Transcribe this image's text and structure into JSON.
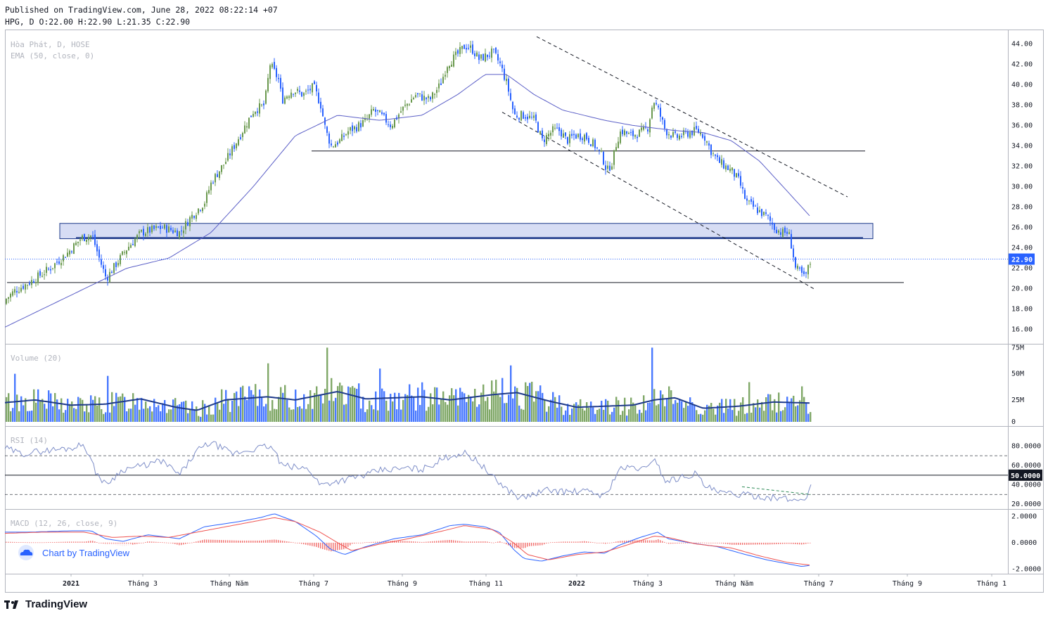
{
  "header": {
    "published": "Published on TradingView.com, June 28, 2022 08:22:14 +07",
    "ohlc": "HPG, D O:22.00 H:22.90 L:21.35 C:22.90"
  },
  "branding": {
    "logo_text": "TradingView",
    "chart_by": "Chart by TradingView"
  },
  "colors": {
    "up": "#6a994e",
    "down": "#2962ff",
    "ema": "#5b5fc7",
    "vol_ma": "#1e3a8a",
    "rsi": "#7e8ec8",
    "macd": "#2962ff",
    "signal": "#ef5350",
    "hist": "#ef5350",
    "zone_fill": "#c9d1f0",
    "zone_stroke": "#1e3a8a",
    "price_tag": "#2962ff"
  },
  "chart_data": [
    {
      "type": "candlestick",
      "title": "Hòa Phát, D, HOSE",
      "indicator": "EMA (50, close, 0)",
      "symbol": "HPG",
      "last_price": "22.90",
      "ylim": [
        14.6,
        45.4
      ],
      "y_ticks": [
        "44.00",
        "42.00",
        "40.00",
        "38.00",
        "36.00",
        "34.00",
        "32.00",
        "30.00",
        "28.00",
        "26.00",
        "24.00",
        "22.00",
        "20.00",
        "18.00",
        "16.00"
      ],
      "x_ticks": [
        "2021",
        "Tháng 3",
        "Tháng Năm",
        "Tháng 7",
        "Tháng 9",
        "Tháng 11",
        "2022",
        "Tháng 3",
        "Tháng Năm",
        "Tháng 7",
        "Tháng 9",
        "Tháng 1"
      ],
      "price_path": [
        [
          0,
          18.5
        ],
        [
          20,
          19.8
        ],
        [
          45,
          20.8
        ],
        [
          70,
          22.0
        ],
        [
          95,
          23.5
        ],
        [
          115,
          25.0
        ],
        [
          130,
          25.2
        ],
        [
          140,
          23.0
        ],
        [
          150,
          21.0
        ],
        [
          160,
          22.0
        ],
        [
          180,
          24.0
        ],
        [
          200,
          25.5
        ],
        [
          230,
          26.0
        ],
        [
          255,
          25.5
        ],
        [
          270,
          27.0
        ],
        [
          290,
          28.5
        ],
        [
          300,
          30.5
        ],
        [
          320,
          32.5
        ],
        [
          340,
          35.0
        ],
        [
          360,
          37.5
        ],
        [
          375,
          38.0
        ],
        [
          383,
          42.0
        ],
        [
          395,
          40.5
        ],
        [
          400,
          38.5
        ],
        [
          415,
          39.5
        ],
        [
          430,
          39.0
        ],
        [
          445,
          39.8
        ],
        [
          455,
          38.0
        ],
        [
          462,
          35.5
        ],
        [
          470,
          34.0
        ],
        [
          482,
          34.5
        ],
        [
          495,
          35.5
        ],
        [
          505,
          35.8
        ],
        [
          520,
          36.5
        ],
        [
          530,
          37.5
        ],
        [
          540,
          37.0
        ],
        [
          555,
          36.0
        ],
        [
          570,
          37.5
        ],
        [
          590,
          39.0
        ],
        [
          610,
          38.5
        ],
        [
          625,
          40.0
        ],
        [
          635,
          42.0
        ],
        [
          650,
          43.0
        ],
        [
          660,
          43.8
        ],
        [
          670,
          43.5
        ],
        [
          680,
          42.5
        ],
        [
          690,
          42.8
        ],
        [
          700,
          43.2
        ],
        [
          710,
          42.0
        ],
        [
          720,
          40.0
        ],
        [
          730,
          37.0
        ],
        [
          745,
          37.0
        ],
        [
          760,
          36.5
        ],
        [
          770,
          34.5
        ],
        [
          785,
          35.5
        ],
        [
          795,
          35.5
        ],
        [
          805,
          34.5
        ],
        [
          815,
          35.0
        ],
        [
          830,
          35.0
        ],
        [
          845,
          34.0
        ],
        [
          855,
          33.0
        ],
        [
          862,
          31.5
        ],
        [
          870,
          32.5
        ],
        [
          876,
          34.5
        ],
        [
          882,
          35.5
        ],
        [
          895,
          35.0
        ],
        [
          910,
          35.3
        ],
        [
          920,
          35.8
        ],
        [
          928,
          38.5
        ],
        [
          935,
          37.5
        ],
        [
          945,
          35.5
        ],
        [
          960,
          34.8
        ],
        [
          975,
          35.2
        ],
        [
          990,
          35.5
        ],
        [
          1000,
          35.0
        ],
        [
          1010,
          33.5
        ],
        [
          1020,
          32.5
        ],
        [
          1030,
          32.0
        ],
        [
          1040,
          31.5
        ],
        [
          1050,
          30.5
        ],
        [
          1060,
          28.5
        ],
        [
          1070,
          28.0
        ],
        [
          1080,
          27.5
        ],
        [
          1090,
          27.0
        ],
        [
          1100,
          26.0
        ],
        [
          1110,
          25.5
        ],
        [
          1120,
          25.5
        ],
        [
          1125,
          24.0
        ],
        [
          1130,
          22.0
        ],
        [
          1138,
          21.5
        ],
        [
          1143,
          21.0
        ],
        [
          1148,
          22.0
        ],
        [
          1153,
          22.9
        ]
      ],
      "ema_path": [
        [
          0,
          16.0
        ],
        [
          60,
          18.0
        ],
        [
          120,
          20.0
        ],
        [
          180,
          22.0
        ],
        [
          240,
          23.0
        ],
        [
          300,
          25.5
        ],
        [
          360,
          30.0
        ],
        [
          420,
          35.0
        ],
        [
          480,
          37.0
        ],
        [
          540,
          36.5
        ],
        [
          600,
          37.0
        ],
        [
          650,
          39.0
        ],
        [
          690,
          41.0
        ],
        [
          720,
          41.0
        ],
        [
          760,
          39.0
        ],
        [
          800,
          37.5
        ],
        [
          860,
          36.5
        ],
        [
          900,
          36.0
        ],
        [
          960,
          35.5
        ],
        [
          1000,
          35.3
        ],
        [
          1040,
          34.5
        ],
        [
          1080,
          32.5
        ],
        [
          1120,
          29.5
        ],
        [
          1153,
          27.0
        ]
      ],
      "support_lines": [
        {
          "x": [
            443,
            1230
          ],
          "y": 33.5
        },
        {
          "x": [
            108,
            1227
          ],
          "y": 25.0
        },
        {
          "x": [
            10,
            1285
          ],
          "y": 20.6
        }
      ],
      "zone": {
        "x": [
          85,
          1241
        ],
        "y": [
          24.9,
          26.4
        ]
      },
      "trendlines": [
        {
          "from": [
            763,
            44.7
          ],
          "to": [
            1205,
            29.0
          ]
        },
        {
          "from": [
            714,
            37.3
          ],
          "to": [
            1157,
            20.0
          ]
        }
      ]
    },
    {
      "type": "bar",
      "title": "Volume (20)",
      "ylim": [
        0,
        78
      ],
      "y_ticks": [
        "75M",
        "50M",
        "25M",
        "0"
      ],
      "spikes": [
        [
          20,
          50
        ],
        [
          153,
          48
        ],
        [
          381,
          60
        ],
        [
          465,
          75
        ],
        [
          538,
          55
        ],
        [
          724,
          58
        ],
        [
          925,
          75
        ],
        [
          1063,
          42
        ],
        [
          1140,
          38
        ]
      ],
      "ma_path": [
        [
          0,
          22
        ],
        [
          50,
          25
        ],
        [
          100,
          20
        ],
        [
          150,
          21
        ],
        [
          200,
          26
        ],
        [
          250,
          18
        ],
        [
          280,
          15
        ],
        [
          320,
          25
        ],
        [
          380,
          28
        ],
        [
          420,
          25
        ],
        [
          480,
          33
        ],
        [
          520,
          26
        ],
        [
          600,
          28
        ],
        [
          640,
          25
        ],
        [
          700,
          30
        ],
        [
          735,
          32
        ],
        [
          780,
          24
        ],
        [
          820,
          18
        ],
        [
          860,
          19
        ],
        [
          900,
          20
        ],
        [
          930,
          25
        ],
        [
          960,
          27
        ],
        [
          1000,
          17
        ],
        [
          1050,
          19
        ],
        [
          1100,
          23
        ],
        [
          1153,
          22
        ]
      ]
    },
    {
      "type": "line",
      "title": "RSI (14)",
      "ylim": [
        15,
        100
      ],
      "y_ticks": [
        "80.0000",
        "60.0000",
        "40.0000",
        "20.0000"
      ],
      "levels": [
        70,
        50,
        30
      ],
      "level_label": "50.0000",
      "rsi_path": [
        [
          0,
          80
        ],
        [
          30,
          72
        ],
        [
          60,
          75
        ],
        [
          100,
          78
        ],
        [
          120,
          82
        ],
        [
          135,
          55
        ],
        [
          150,
          40
        ],
        [
          175,
          56
        ],
        [
          205,
          60
        ],
        [
          230,
          65
        ],
        [
          255,
          50
        ],
        [
          280,
          75
        ],
        [
          300,
          84
        ],
        [
          330,
          72
        ],
        [
          380,
          80
        ],
        [
          390,
          76
        ],
        [
          400,
          60
        ],
        [
          440,
          56
        ],
        [
          455,
          40
        ],
        [
          480,
          44
        ],
        [
          520,
          50
        ],
        [
          540,
          55
        ],
        [
          580,
          57
        ],
        [
          600,
          56
        ],
        [
          640,
          70
        ],
        [
          660,
          73
        ],
        [
          680,
          64
        ],
        [
          700,
          48
        ],
        [
          720,
          36
        ],
        [
          740,
          26
        ],
        [
          780,
          35
        ],
        [
          800,
          33
        ],
        [
          840,
          33
        ],
        [
          860,
          28
        ],
        [
          880,
          56
        ],
        [
          900,
          58
        ],
        [
          920,
          56
        ],
        [
          930,
          70
        ],
        [
          945,
          44
        ],
        [
          960,
          46
        ],
        [
          990,
          52
        ],
        [
          1000,
          40
        ],
        [
          1020,
          32
        ],
        [
          1050,
          30
        ],
        [
          1080,
          28
        ],
        [
          1110,
          26
        ],
        [
          1130,
          24
        ],
        [
          1145,
          26
        ],
        [
          1153,
          40
        ]
      ],
      "dashed_trend": {
        "from": [
          1055,
          38
        ],
        "to": [
          1153,
          30
        ]
      }
    },
    {
      "type": "line",
      "title": "MACD (12, 26, close, 9)",
      "ylim": [
        -2.35,
        2.5
      ],
      "y_ticks": [
        "2.0000",
        "0.0000",
        "-2.0000"
      ],
      "macd_path": [
        [
          0,
          0.8
        ],
        [
          40,
          0.8
        ],
        [
          100,
          0.9
        ],
        [
          130,
          0.9
        ],
        [
          150,
          0.3
        ],
        [
          175,
          0.1
        ],
        [
          210,
          0.6
        ],
        [
          255,
          0.3
        ],
        [
          290,
          1.2
        ],
        [
          340,
          1.6
        ],
        [
          370,
          1.9
        ],
        [
          390,
          2.2
        ],
        [
          420,
          1.6
        ],
        [
          450,
          0.5
        ],
        [
          470,
          -0.5
        ],
        [
          490,
          -0.9
        ],
        [
          520,
          -0.3
        ],
        [
          560,
          0.3
        ],
        [
          600,
          0.6
        ],
        [
          640,
          1.3
        ],
        [
          660,
          1.4
        ],
        [
          690,
          1.2
        ],
        [
          710,
          0.8
        ],
        [
          730,
          -0.5
        ],
        [
          745,
          -1.2
        ],
        [
          770,
          -1.4
        ],
        [
          800,
          -1.0
        ],
        [
          830,
          -0.7
        ],
        [
          860,
          -0.8
        ],
        [
          880,
          -0.2
        ],
        [
          910,
          0.4
        ],
        [
          935,
          0.8
        ],
        [
          950,
          0.3
        ],
        [
          980,
          0.0
        ],
        [
          1020,
          -0.3
        ],
        [
          1060,
          -0.9
        ],
        [
          1090,
          -1.3
        ],
        [
          1120,
          -1.6
        ],
        [
          1140,
          -1.8
        ],
        [
          1153,
          -1.7
        ]
      ],
      "signal_path": [
        [
          0,
          0.7
        ],
        [
          60,
          0.8
        ],
        [
          120,
          0.8
        ],
        [
          160,
          0.4
        ],
        [
          200,
          0.5
        ],
        [
          240,
          0.4
        ],
        [
          290,
          0.9
        ],
        [
          340,
          1.4
        ],
        [
          390,
          1.9
        ],
        [
          420,
          1.6
        ],
        [
          455,
          0.8
        ],
        [
          480,
          0.0
        ],
        [
          500,
          -0.6
        ],
        [
          540,
          -0.1
        ],
        [
          580,
          0.3
        ],
        [
          630,
          0.9
        ],
        [
          660,
          1.3
        ],
        [
          700,
          1.0
        ],
        [
          730,
          0.0
        ],
        [
          750,
          -0.9
        ],
        [
          780,
          -1.3
        ],
        [
          820,
          -0.9
        ],
        [
          860,
          -0.7
        ],
        [
          890,
          -0.2
        ],
        [
          930,
          0.5
        ],
        [
          950,
          0.4
        ],
        [
          990,
          -0.1
        ],
        [
          1040,
          -0.4
        ],
        [
          1080,
          -1.0
        ],
        [
          1120,
          -1.5
        ],
        [
          1153,
          -1.7
        ]
      ]
    }
  ]
}
